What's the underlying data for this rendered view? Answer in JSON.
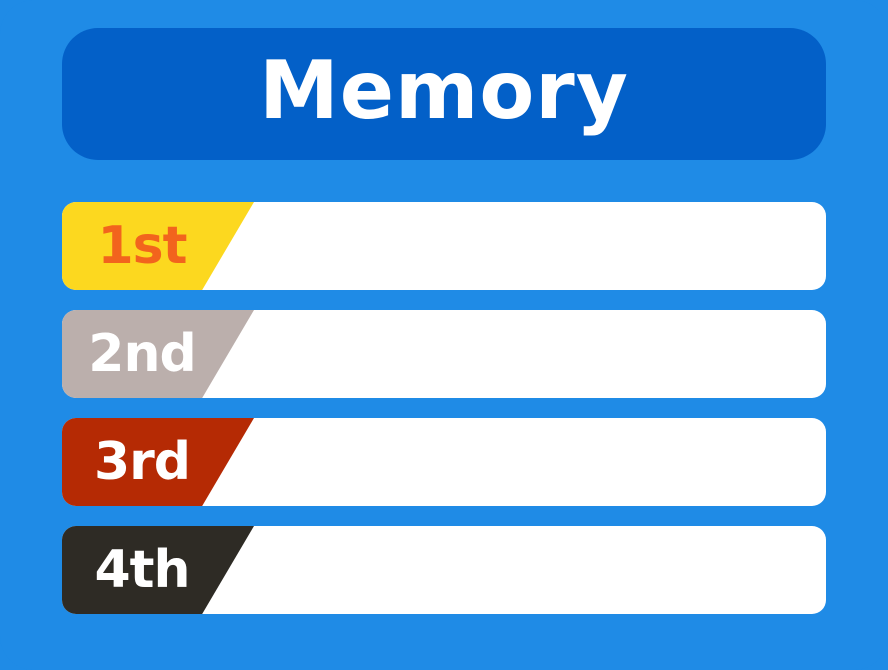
{
  "title": "Memory",
  "leaderboard": [
    {
      "rank": "1st",
      "entry": "",
      "badge_color": "#fcd81f"
    },
    {
      "rank": "2nd",
      "entry": "",
      "badge_color": "#bbafac"
    },
    {
      "rank": "3rd",
      "entry": "",
      "badge_color": "#b52a04"
    },
    {
      "rank": "4th",
      "entry": "",
      "badge_color": "#2e2b25"
    }
  ],
  "colors": {
    "panel": "#1f8be6",
    "title_bar": "#0360c8",
    "row_background": "#ffffff",
    "first_label": "#f2641d"
  }
}
